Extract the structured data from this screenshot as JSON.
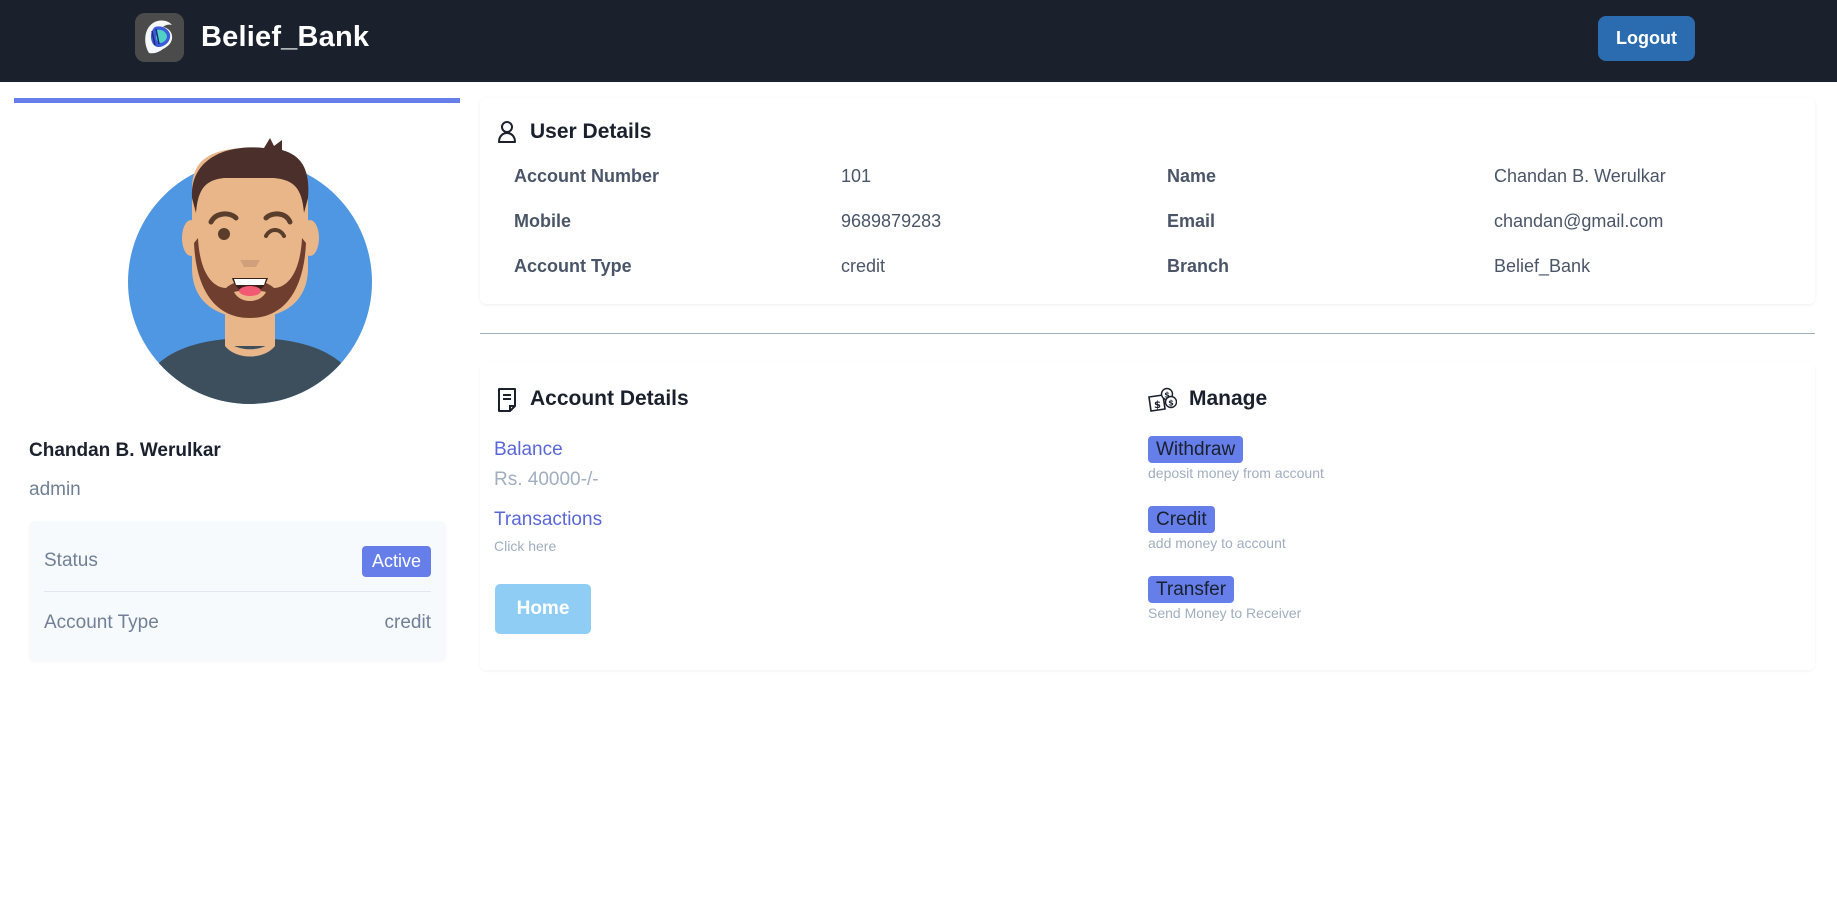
{
  "header": {
    "brand": "Belief_Bank",
    "logo_icon": "lion-logo-icon",
    "logout_label": "Logout"
  },
  "profile": {
    "name": "Chandan B. Werulkar",
    "role": "admin",
    "avatar_icon": "user-avatar-illustration",
    "status": {
      "rows": [
        {
          "label": "Status",
          "value": "Active"
        },
        {
          "label": "Account Type",
          "value": "credit"
        }
      ]
    }
  },
  "user_details": {
    "title": "User Details",
    "icon": "user-icon",
    "rows": [
      {
        "k1": "Account Number",
        "v1": "101",
        "k2": "Name",
        "v2": "Chandan B. Werulkar"
      },
      {
        "k1": "Mobile",
        "v1": "9689879283",
        "k2": "Email",
        "v2": "chandan@gmail.com"
      },
      {
        "k1": "Account Type",
        "v1": "credit",
        "k2": "Branch",
        "v2": "Belief_Bank"
      }
    ]
  },
  "account_details": {
    "title": "Account Details",
    "icon": "receipt-icon",
    "balance_label": "Balance",
    "balance_value": "Rs. 40000-/-",
    "transactions_label": "Transactions",
    "transactions_sub": "Click here",
    "home_label": "Home"
  },
  "manage": {
    "title": "Manage",
    "icon": "money-icon",
    "items": [
      {
        "label": "Withdraw",
        "desc": "deposit money from account"
      },
      {
        "label": "Credit",
        "desc": "add money to account"
      },
      {
        "label": "Transfer",
        "desc": "Send Money to Receiver"
      }
    ]
  },
  "colors": {
    "navbar": "#1a202c",
    "primary": "#2b6cb0",
    "accent": "#667eea",
    "link": "#5a67d8",
    "muted": "#a0aec0",
    "home_button": "#90cdf4"
  }
}
